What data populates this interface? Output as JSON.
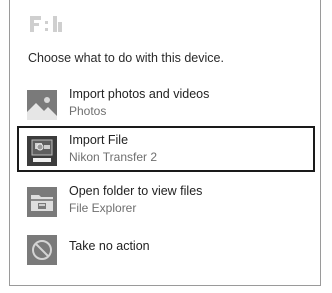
{
  "dialog": {
    "drive_title": "F:\\",
    "prompt": "Choose what to do with this device.",
    "options": [
      {
        "title": "Import photos and videos",
        "subtitle": "Photos",
        "icon": "photos-icon",
        "selected": false
      },
      {
        "title": "Import File",
        "subtitle": "Nikon Transfer 2",
        "icon": "nikon-transfer-icon",
        "selected": true
      },
      {
        "title": "Open folder to view files",
        "subtitle": "File Explorer",
        "icon": "file-explorer-icon",
        "selected": false
      },
      {
        "title": "Take no action",
        "subtitle": "",
        "icon": "no-action-icon",
        "selected": false
      }
    ],
    "colors": {
      "icon_gray": "#7a7a7a",
      "selection_border": "#1a1a1a",
      "subtitle_text": "#6f6f6f"
    }
  }
}
